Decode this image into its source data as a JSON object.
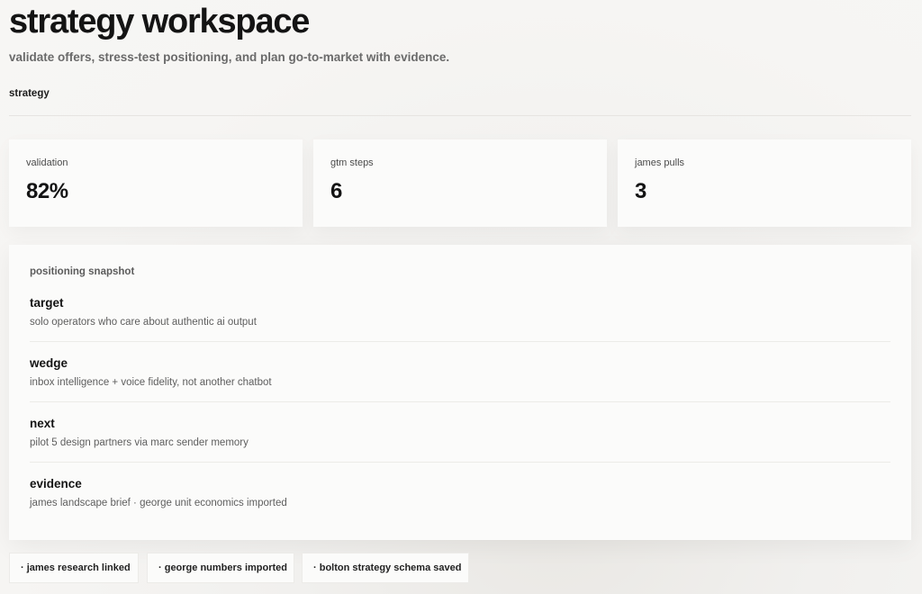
{
  "header": {
    "title": "strategy workspace",
    "subtitle": "validate offers, stress-test positioning, and plan go-to-market with evidence.",
    "section_tab": "strategy"
  },
  "stats": [
    {
      "label": "validation",
      "value": "82%"
    },
    {
      "label": "gtm steps",
      "value": "6"
    },
    {
      "label": "james pulls",
      "value": "3"
    }
  ],
  "positioning": {
    "label": "positioning snapshot",
    "rows": [
      {
        "title": "target",
        "text": "solo operators who care about authentic ai output"
      },
      {
        "title": "wedge",
        "text": "inbox intelligence + voice fidelity, not another chatbot"
      },
      {
        "title": "next",
        "text": "pilot 5 design partners via marc sender memory"
      },
      {
        "title": "evidence",
        "text": "james landscape brief · george unit economics imported"
      }
    ]
  },
  "chips": [
    "· james research linked",
    "· george numbers imported",
    "· bolton strategy schema saved"
  ]
}
